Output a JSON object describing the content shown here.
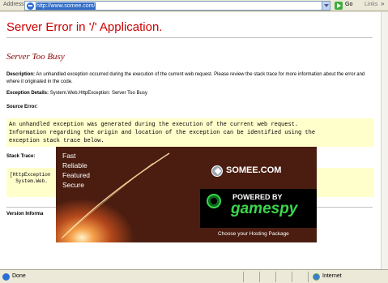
{
  "browser": {
    "address_label": "Address",
    "url": "http://www.somee.com/",
    "go_label": "Go",
    "links_label": "Links",
    "links_chevron": "»"
  },
  "page": {
    "title": "Server Error in '/' Application.",
    "subtitle": "Server Too Busy",
    "description_label": "Description:",
    "description_text": "An unhandled exception occurred during the execution of the current web request. Please review the stack trace for more information about the error and where it originated in the code.",
    "exception_label": "Exception Details:",
    "exception_text": "System.Web.HttpException: Server Too Busy",
    "source_error_label": "Source Error:",
    "source_error_lines": [
      "An unhandled exception was generated during the execution of the current web request.",
      "Information regarding the origin and location of the exception can be identified using the",
      "exception stack trace below."
    ],
    "stack_trace_label": "Stack Trace:",
    "stack_trace_lines": [
      "[HttpException",
      "  System.Web."
    ],
    "version_label": "Version Informa"
  },
  "ad": {
    "words": [
      "Fast",
      "Reliable",
      "Featured",
      "Secure"
    ],
    "logo": "SOMEE.COM",
    "powered_by": "POWERED BY",
    "gamespy": "gamespy",
    "cta": "Choose your Hosting Package"
  },
  "status": {
    "text": "Done",
    "zone": "Internet"
  },
  "colors": {
    "title_red": "#cc0000",
    "subtitle_red": "#8b0000",
    "code_bg": "#ffffcc",
    "gamespy_green": "#3ad64a"
  }
}
